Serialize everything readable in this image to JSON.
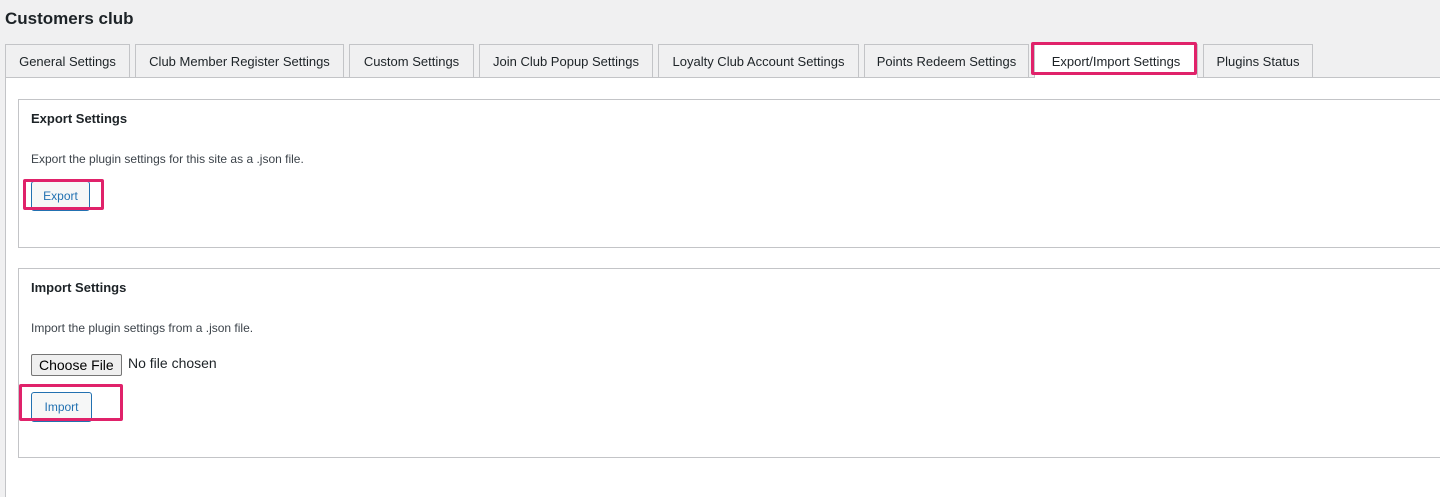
{
  "page": {
    "title": "Customers club"
  },
  "tabs": [
    {
      "label": "General Settings"
    },
    {
      "label": "Club Member Register Settings"
    },
    {
      "label": "Custom Settings"
    },
    {
      "label": "Join Club Popup Settings"
    },
    {
      "label": "Loyalty Club Account Settings"
    },
    {
      "label": "Points Redeem Settings"
    },
    {
      "label": "Export/Import Settings"
    },
    {
      "label": "Plugins Status"
    }
  ],
  "active_tab": "Export/Import Settings",
  "export": {
    "heading": "Export Settings",
    "description": "Export the plugin settings for this site as a .json file.",
    "button_label": "Export"
  },
  "import": {
    "heading": "Import Settings",
    "description": "Import the plugin settings from a .json file.",
    "file_button_label": "Choose File",
    "file_status": "No file chosen",
    "button_label": "Import"
  },
  "colors": {
    "highlight": "#e0226a",
    "primary": "#2271b1",
    "background": "#f0f0f1"
  }
}
